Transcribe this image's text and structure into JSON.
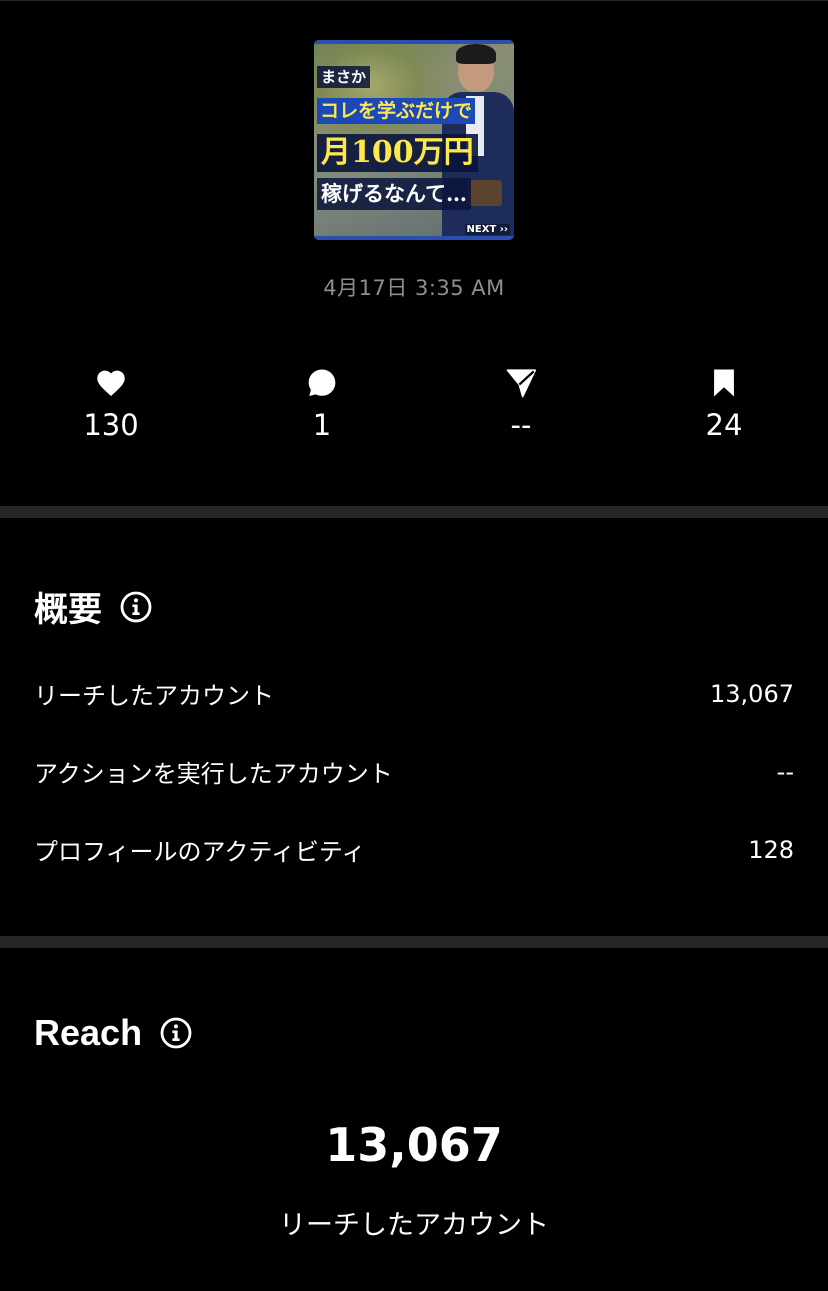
{
  "post": {
    "thumbnail": {
      "line1": "まさか",
      "line2": "コレを学ぶだけで",
      "line3": "月100万円",
      "line4": "稼げるなんて…",
      "next_label": "NEXT ››"
    },
    "date": "4月17日 3:35 AM"
  },
  "stats": [
    {
      "icon": "heart-icon",
      "value": "130"
    },
    {
      "icon": "comment-icon",
      "value": "1"
    },
    {
      "icon": "send-icon",
      "value": "--"
    },
    {
      "icon": "bookmark-icon",
      "value": "24"
    }
  ],
  "overview": {
    "title": "概要",
    "rows": [
      {
        "label": "リーチしたアカウント",
        "value": "13,067"
      },
      {
        "label": "アクションを実行したアカウント",
        "value": "--"
      },
      {
        "label": "プロフィールのアクティビティ",
        "value": "128"
      }
    ]
  },
  "reach": {
    "title": "Reach",
    "total": "13,067",
    "label": "リーチしたアカウント"
  },
  "colors": {
    "background": "#000000",
    "divider": "#262626",
    "muted_text": "#8e8e8e",
    "thumb_accent_blue": "#1d49b8",
    "thumb_accent_yellow": "#ffe84a"
  }
}
